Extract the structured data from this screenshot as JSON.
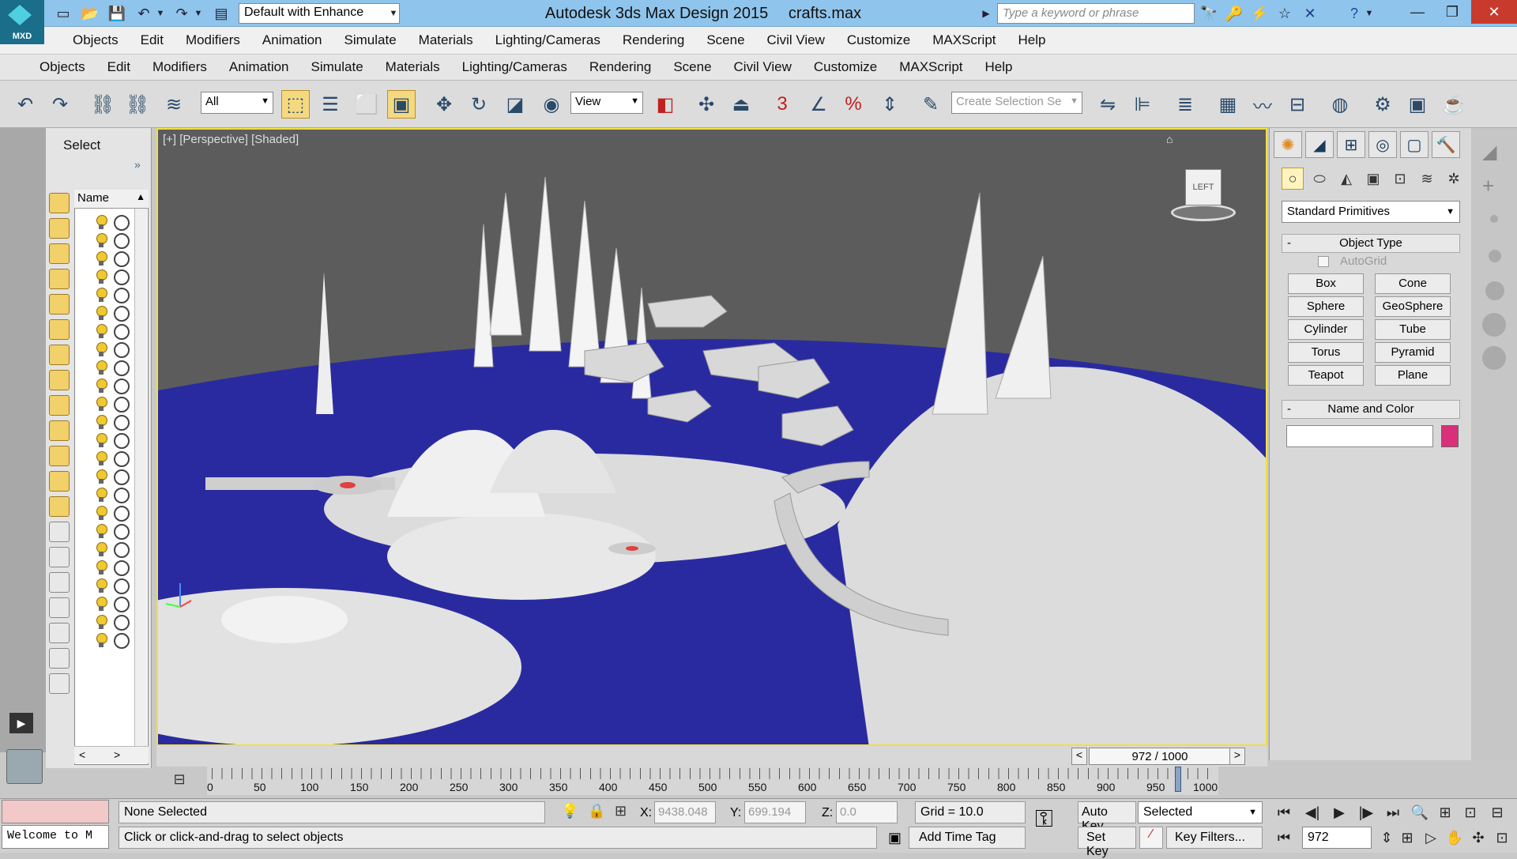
{
  "title_bar": {
    "app_title": "Autodesk 3ds Max Design 2015",
    "file_name": "crafts.max",
    "logo_text": "MXD",
    "workspace": "Default with Enhance",
    "search_placeholder": "Type a keyword or phrase"
  },
  "menu1": [
    "Objects",
    "Edit",
    "Modifiers",
    "Animation",
    "Simulate",
    "Materials",
    "Lighting/Cameras",
    "Rendering",
    "Scene",
    "Civil View",
    "Customize",
    "MAXScript",
    "Help"
  ],
  "menu2": [
    "Objects",
    "Edit",
    "Modifiers",
    "Animation",
    "Simulate",
    "Materials",
    "Lighting/Cameras",
    "Rendering",
    "Scene",
    "Civil View",
    "Customize",
    "MAXScript",
    "Help"
  ],
  "toolbar": {
    "filter_value": "All",
    "ref_coord_value": "View",
    "selection_set_placeholder": "Create Selection Se",
    "snap_label": "3"
  },
  "scene_explorer": {
    "title": "Select",
    "column_name": "Name",
    "expand_glyph": "»"
  },
  "viewport": {
    "label": "[+] [Perspective] [Shaded]",
    "cube_label": "LEFT",
    "colors": {
      "sky": "#5c5c5c",
      "water": "#2a2aa0",
      "structures": "#e6e6e6",
      "highlight": "#f0e040"
    }
  },
  "command_panel": {
    "primitive_type": "Standard Primitives",
    "object_type_title": "Object Type",
    "autogrid_label": "AutoGrid",
    "buttons": [
      "Box",
      "Cone",
      "Sphere",
      "GeoSphere",
      "Cylinder",
      "Tube",
      "Torus",
      "Pyramid",
      "Teapot",
      "Plane"
    ],
    "name_color_title": "Name and Color",
    "object_color": "#d8307a"
  },
  "timeline": {
    "current": "972 / 1000",
    "ticks": [
      "0",
      "50",
      "100",
      "150",
      "200",
      "250",
      "300",
      "350",
      "400",
      "450",
      "500",
      "550",
      "600",
      "650",
      "700",
      "750",
      "800",
      "850",
      "900",
      "950",
      "1000"
    ],
    "position_fraction": 0.972
  },
  "status": {
    "listener_text": "Welcome to M",
    "selection": "None Selected",
    "prompt": "Click or click-and-drag to select objects",
    "x_label": "X:",
    "x_value": "9438.048",
    "y_label": "Y:",
    "y_value": "699.194",
    "z_label": "Z:",
    "z_value": "0.0",
    "grid": "Grid = 10.0",
    "add_time_tag": "Add Time Tag",
    "auto_key": "Auto Key",
    "set_key": "Set Key",
    "selected_dd": "Selected",
    "key_filters": "Key Filters...",
    "frame": "972"
  }
}
